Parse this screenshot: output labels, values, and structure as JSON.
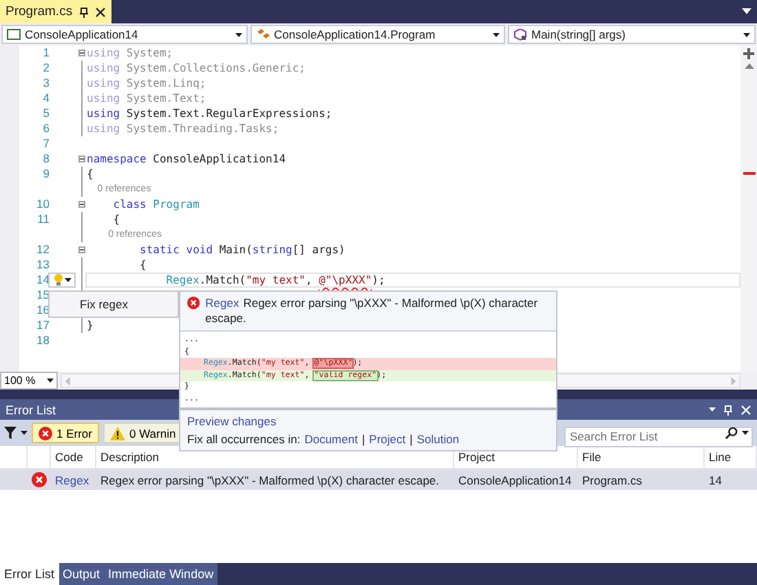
{
  "editor_tab": {
    "label": "Program.cs",
    "selected": true
  },
  "nav_bar": [
    {
      "kind": "project",
      "label": "ConsoleApplication14"
    },
    {
      "kind": "class",
      "label": "ConsoleApplication14.Program"
    },
    {
      "kind": "method",
      "label": "Main(string[] args)"
    }
  ],
  "code_lines": [
    {
      "kind": "code",
      "number": "1",
      "faded": true,
      "current": false,
      "collapsible": true,
      "tokens": [
        {
          "kind": "keyword",
          "text": "using"
        },
        {
          "kind": "plain",
          "text": " System;"
        }
      ]
    },
    {
      "kind": "code",
      "number": "2",
      "faded": true,
      "current": false,
      "collapsible": false,
      "in_block": true,
      "tokens": [
        {
          "kind": "keyword",
          "text": "using"
        },
        {
          "kind": "plain",
          "text": " System.Collections.Generic;"
        }
      ]
    },
    {
      "kind": "code",
      "number": "3",
      "faded": true,
      "current": false,
      "collapsible": false,
      "in_block": true,
      "tokens": [
        {
          "kind": "keyword",
          "text": "using"
        },
        {
          "kind": "plain",
          "text": " System.Linq;"
        }
      ]
    },
    {
      "kind": "code",
      "number": "4",
      "faded": true,
      "current": false,
      "collapsible": false,
      "in_block": true,
      "tokens": [
        {
          "kind": "keyword",
          "text": "using"
        },
        {
          "kind": "plain",
          "text": " System.Text;"
        }
      ]
    },
    {
      "kind": "code",
      "number": "5",
      "faded": false,
      "current": false,
      "collapsible": false,
      "in_block": true,
      "tokens": [
        {
          "kind": "keyword",
          "text": "using"
        },
        {
          "kind": "plain",
          "text": " System.Text.RegularExpressions;"
        }
      ]
    },
    {
      "kind": "code",
      "number": "6",
      "faded": true,
      "current": false,
      "collapsible": false,
      "in_block": true,
      "tokens": [
        {
          "kind": "keyword",
          "text": "using"
        },
        {
          "kind": "plain",
          "text": " System.Threading.Tasks;"
        }
      ]
    },
    {
      "kind": "code",
      "number": "7",
      "current": false,
      "collapsible": false,
      "in_block": false
    },
    {
      "kind": "code",
      "number": "8",
      "faded": false,
      "current": false,
      "collapsible": true,
      "tokens": [
        {
          "kind": "keyword",
          "text": "namespace"
        },
        {
          "kind": "plain",
          "text": " ConsoleApplication14"
        }
      ]
    },
    {
      "kind": "code",
      "number": "9",
      "faded": false,
      "current": false,
      "collapsible": false,
      "in_block": true,
      "tokens": [
        {
          "kind": "plain",
          "text": "{"
        }
      ]
    },
    {
      "kind": "lens",
      "text": "0 references"
    },
    {
      "kind": "code",
      "number": "10",
      "faded": false,
      "current": false,
      "collapsible": true,
      "tokens": [
        {
          "kind": "keyword",
          "text": "    class"
        },
        {
          "kind": "type",
          "text": " Program"
        }
      ]
    },
    {
      "kind": "code",
      "number": "11",
      "faded": false,
      "current": false,
      "collapsible": false,
      "in_block": true,
      "tokens": [
        {
          "kind": "plain",
          "text": "    {"
        }
      ]
    },
    {
      "kind": "lens",
      "text": "0 references"
    },
    {
      "kind": "code",
      "number": "12",
      "faded": false,
      "current": false,
      "collapsible": true,
      "tokens": [
        {
          "kind": "keyword",
          "text": "        static void"
        },
        {
          "kind": "plain",
          "text": " Main("
        },
        {
          "kind": "keyword",
          "text": "string"
        },
        {
          "kind": "plain",
          "text": "[] args)"
        }
      ]
    },
    {
      "kind": "code",
      "number": "13",
      "faded": false,
      "current": false,
      "collapsible": false,
      "in_block": true,
      "tokens": [
        {
          "kind": "plain",
          "text": "        {"
        }
      ]
    },
    {
      "kind": "code",
      "number": "14",
      "faded": false,
      "current": true,
      "collapsible": false,
      "in_block": true,
      "tokens": [
        {
          "kind": "type",
          "text": "            Regex"
        },
        {
          "kind": "plain",
          "text": ".Match("
        },
        {
          "kind": "string",
          "text": "\"my text\""
        },
        {
          "kind": "plain",
          "text": ", "
        },
        {
          "kind": "error",
          "text": "@\"\\pXXX\""
        },
        {
          "kind": "plain",
          "text": ");"
        }
      ]
    },
    {
      "kind": "code",
      "number": "15",
      "current": false,
      "collapsible": false,
      "in_block": true
    },
    {
      "kind": "code",
      "number": "16",
      "current": false
    },
    {
      "kind": "code",
      "number": "17",
      "faded": false,
      "current": false,
      "collapsible": false,
      "in_block": true,
      "tokens": [
        {
          "kind": "plain",
          "text": "}"
        }
      ]
    },
    {
      "kind": "code",
      "number": "18",
      "current": false,
      "collapsible": false,
      "in_block": false
    }
  ],
  "quick_actions": {
    "items": [
      {
        "label": "Fix regex"
      }
    ]
  },
  "preview": {
    "code": "Regex",
    "message": "Regex error parsing \"\\pXXX\" - Malformed \\p(X) character escape.",
    "lines": [
      {
        "kind": "context",
        "tokens": [
          {
            "kind": "plain",
            "text": "..."
          }
        ]
      },
      {
        "kind": "context",
        "tokens": [
          {
            "kind": "plain",
            "text": "{"
          }
        ]
      },
      {
        "kind": "removed",
        "tokens": [
          {
            "kind": "type",
            "text": "    Regex"
          },
          {
            "kind": "plain",
            "text": ".Match("
          },
          {
            "kind": "string",
            "text": "\"my text\""
          },
          {
            "kind": "plain",
            "text": ", "
          },
          {
            "kind": "removed",
            "text": "@\"\\pXXX\""
          },
          {
            "kind": "plain",
            "text": ");"
          }
        ]
      },
      {
        "kind": "added",
        "tokens": [
          {
            "kind": "type",
            "text": "    Regex"
          },
          {
            "kind": "plain",
            "text": ".Match("
          },
          {
            "kind": "string",
            "text": "\"my text\""
          },
          {
            "kind": "plain",
            "text": ", "
          },
          {
            "kind": "added",
            "text": "\"valid regex\""
          },
          {
            "kind": "plain",
            "text": ");"
          }
        ]
      },
      {
        "kind": "context",
        "tokens": [
          {
            "kind": "plain",
            "text": "}"
          }
        ]
      },
      {
        "kind": "context",
        "tokens": [
          {
            "kind": "plain",
            "text": "..."
          }
        ]
      }
    ],
    "preview_link": "Preview changes",
    "fix_all": [
      {
        "kind": "label",
        "text": "Fix all occurrences in:"
      },
      {
        "kind": "link",
        "text": "Document"
      },
      {
        "kind": "separator",
        "text": "|"
      },
      {
        "kind": "link",
        "text": "Project"
      },
      {
        "kind": "separator",
        "text": "|"
      },
      {
        "kind": "link",
        "text": "Solution"
      }
    ]
  },
  "zoom": {
    "value": "100 %"
  },
  "error_list": {
    "title": "Error List",
    "filters": [
      {
        "kind": "error",
        "label": "1 Error",
        "selected": true
      },
      {
        "kind": "warning",
        "label": "0 Warnin",
        "selected": false
      }
    ],
    "search": {
      "placeholder": "Search Error List"
    },
    "columns": [
      "Code",
      "Description",
      "Project",
      "File",
      "Line"
    ],
    "rows": [
      {
        "kind": "error",
        "code": "Regex",
        "description": "Regex error parsing \"\\pXXX\" - Malformed \\p(X) character escape.",
        "project": "ConsoleApplication14",
        "file": "Program.cs",
        "line": "14",
        "selected": true
      }
    ]
  },
  "bottom_tabs": [
    {
      "label": "Error List",
      "selected": true
    },
    {
      "label": "Output",
      "selected": false
    },
    {
      "label": "Immediate Window",
      "selected": false
    }
  ]
}
